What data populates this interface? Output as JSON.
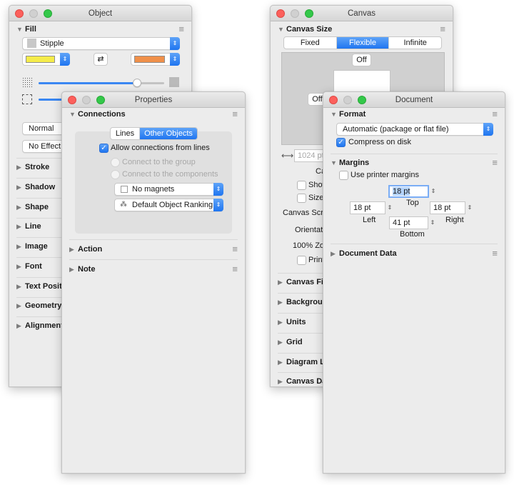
{
  "object_window": {
    "title": "Object",
    "fill": {
      "header": "Fill",
      "fill_type": "Stipple",
      "color1": "#f5ec4a",
      "color2": "#f0904a",
      "swap_icon": "swap-arrows-icon",
      "blend_mode": "Normal",
      "effect": "No Effect",
      "density_slider_value": 0.85
    },
    "sections": [
      "Stroke",
      "Shadow",
      "Shape",
      "Line",
      "Image",
      "Font",
      "Text Positio",
      "Geometry",
      "Alignment"
    ]
  },
  "properties_window": {
    "title": "Properties",
    "connections": {
      "header": "Connections",
      "tabs": [
        "Lines",
        "Other Objects"
      ],
      "selected_tab": "Other Objects",
      "allow_connections_label": "Allow connections from lines",
      "allow_connections_checked": true,
      "radio_group": "Connect to the group",
      "radio_components": "Connect to the components",
      "magnets": "No magnets",
      "ranking": "Default Object Ranking"
    },
    "sections": [
      "Action",
      "Note"
    ]
  },
  "canvas_window": {
    "title": "Canvas",
    "canvas_size": {
      "header": "Canvas Size",
      "modes": [
        "Fixed",
        "Flexible",
        "Infinite"
      ],
      "selected_mode": "Flexible",
      "top_toggle": "Off",
      "left_toggle": "Off",
      "width_value": "1024 pt",
      "partial_labels": [
        "Ca",
        "Show",
        "Size",
        "Canvas Scrol",
        "Orientati",
        "100% Zoo",
        "Print"
      ]
    },
    "sections": [
      "Canvas Fill",
      "Backgroun",
      "Units",
      "Grid",
      "Diagram La",
      "Canvas Dat"
    ]
  },
  "document_window": {
    "title": "Document",
    "format": {
      "header": "Format",
      "file_format": "Automatic (package or flat file)",
      "compress_label": "Compress on disk",
      "compress_checked": true
    },
    "margins": {
      "header": "Margins",
      "use_printer_label": "Use printer margins",
      "use_printer_checked": false,
      "top": "18 pt",
      "top_label": "Top",
      "left": "18 pt",
      "left_label": "Left",
      "right": "18 pt",
      "right_label": "Right",
      "bottom": "41 pt",
      "bottom_label": "Bottom"
    },
    "sections": [
      "Document Data"
    ]
  }
}
